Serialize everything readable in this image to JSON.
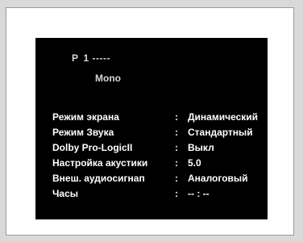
{
  "osd": {
    "program": "P",
    "channel": "1 -----",
    "audio_mode": "Mono",
    "separator": ":",
    "settings": [
      {
        "label": "Режим экрана",
        "value": "Динамический"
      },
      {
        "label": "Режим Звука",
        "value": "Стандартный"
      },
      {
        "label": "Dolby Pro-LogicII",
        "value": "Выкл"
      },
      {
        "label": "Настройка акустики",
        "value": "5.0"
      },
      {
        "label": "Внеш. аудиосигнап",
        "value": "Аналоговый"
      },
      {
        "label": "Часы",
        "value": "-- : --"
      }
    ]
  }
}
